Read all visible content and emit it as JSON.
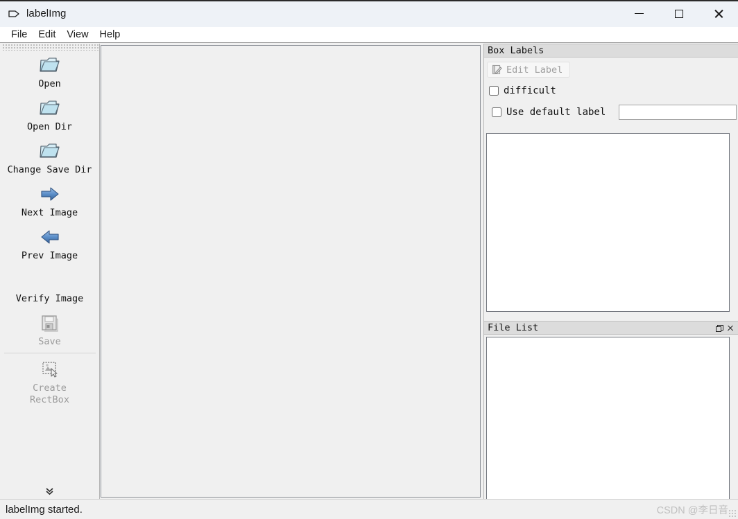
{
  "window": {
    "title": "labelImg",
    "icon": "tag-icon",
    "controls": {
      "minimize": "minimize-icon",
      "maximize": "maximize-icon",
      "close": "close-icon"
    }
  },
  "menubar": {
    "items": [
      {
        "label": "File"
      },
      {
        "label": "Edit"
      },
      {
        "label": "View"
      },
      {
        "label": "Help"
      }
    ]
  },
  "toolbar": {
    "items": [
      {
        "label": "Open",
        "icon": "open-folder-icon",
        "enabled": true
      },
      {
        "label": "Open Dir",
        "icon": "open-folder-icon",
        "enabled": true
      },
      {
        "label": "Change Save Dir",
        "icon": "open-folder-icon",
        "enabled": true
      },
      {
        "label": "Next Image",
        "icon": "arrow-right-icon",
        "enabled": true
      },
      {
        "label": "Prev Image",
        "icon": "arrow-left-icon",
        "enabled": true
      },
      {
        "label": "Verify Image",
        "icon": "blank-icon",
        "enabled": true
      },
      {
        "label": "Save",
        "icon": "floppy-disk-icon",
        "enabled": false
      },
      {
        "label": "Create\nRectBox",
        "icon": "create-rectbox-icon",
        "enabled": false
      }
    ],
    "expand_glyph": "chevron-double-down-icon"
  },
  "box_labels_dock": {
    "title": "Box Labels",
    "edit_label_button": {
      "label": "Edit Label",
      "icon": "edit-pencil-icon",
      "enabled": false
    },
    "difficult_checkbox": {
      "label": "difficult",
      "checked": false
    },
    "use_default_label_checkbox": {
      "label": "Use default label",
      "checked": false
    },
    "default_label_input": {
      "value": "",
      "placeholder": ""
    },
    "label_list_items": []
  },
  "file_list_dock": {
    "title": "File List",
    "float_button": "float-icon",
    "close_button": "close-icon",
    "items": []
  },
  "statusbar": {
    "message": "labelImg started.",
    "watermark": "CSDN @李日音"
  },
  "colors": {
    "titlebar_bg": "#eef2f7",
    "menubar_bg": "#ffffff",
    "chrome_bg": "#f0f0f0",
    "dock_title_bg": "#dcdcdc",
    "list_bg": "#ffffff",
    "icon_blue": "#4a7fbd",
    "disabled_text": "#9b9b9b",
    "watermark_text": "#c0c0c0"
  }
}
